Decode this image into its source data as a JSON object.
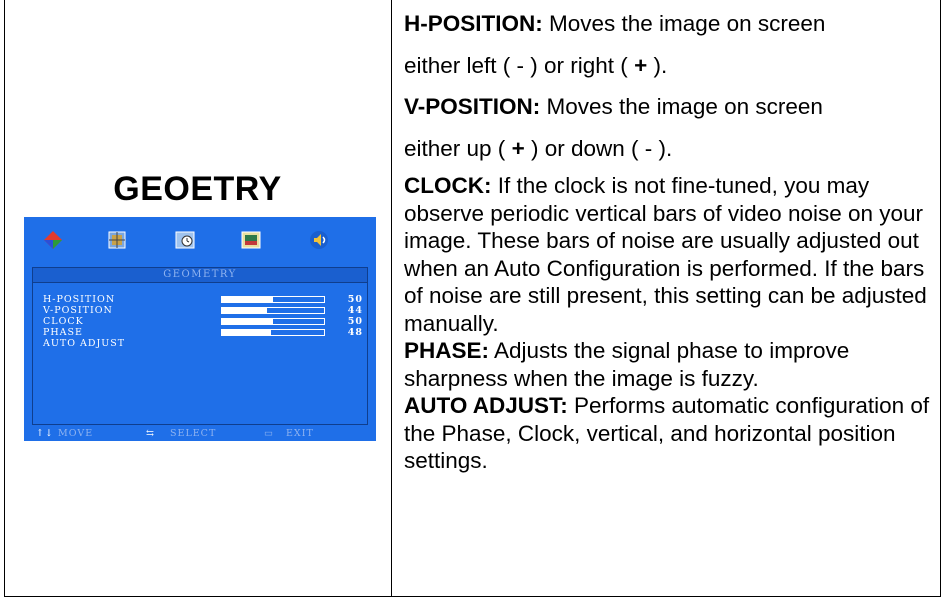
{
  "left": {
    "title": "GEOETRY",
    "osd": {
      "header": "GEOMETRY",
      "icons": [
        "color-icon",
        "picture-icon",
        "clock-icon",
        "display-icon",
        "audio-icon"
      ],
      "rows": [
        {
          "label": "H-POSITION",
          "value": "50",
          "level": 0.5
        },
        {
          "label": "V-POSITION",
          "value": "44",
          "level": 0.44
        },
        {
          "label": "CLOCK",
          "value": "50",
          "level": 0.5
        },
        {
          "label": "PHASE",
          "value": "48",
          "level": 0.48
        },
        {
          "label": "AUTO ADJUST",
          "value": "",
          "level": null
        }
      ],
      "footer": {
        "move": "MOVE",
        "select": "SELECT",
        "exit": "EXIT"
      },
      "colors": {
        "background": "#1f6fe8",
        "text": "#ffffff",
        "dim_text": "#8fb3f0"
      }
    }
  },
  "right": {
    "h_position": {
      "head": "H-POSITION:",
      "text1": " Moves the image on screen",
      "text2a": "either left ( - ) or right ( ",
      "plus": "+",
      "text2b": " )."
    },
    "v_position": {
      "head": "V-POSITION:",
      "text1": " Moves the image on screen",
      "text2a": "either up ( ",
      "plus": "+",
      "text2b": " ) or down ( - )."
    },
    "clock": {
      "head": "CLOCK:",
      "text": " If the clock is not fine-tuned, you may observe periodic vertical bars of video noise on your image. These bars of noise are usually adjusted out when an Auto Configuration is performed. If the bars of noise are still present, this setting can be adjusted manually."
    },
    "phase": {
      "head": "PHASE:",
      "text": " Adjusts the signal phase to improve sharpness when the image is fuzzy."
    },
    "auto_adjust": {
      "head": "AUTO ADJUST:",
      "text": " Performs automatic configuration of the Phase, Clock, vertical, and horizontal position settings."
    }
  }
}
